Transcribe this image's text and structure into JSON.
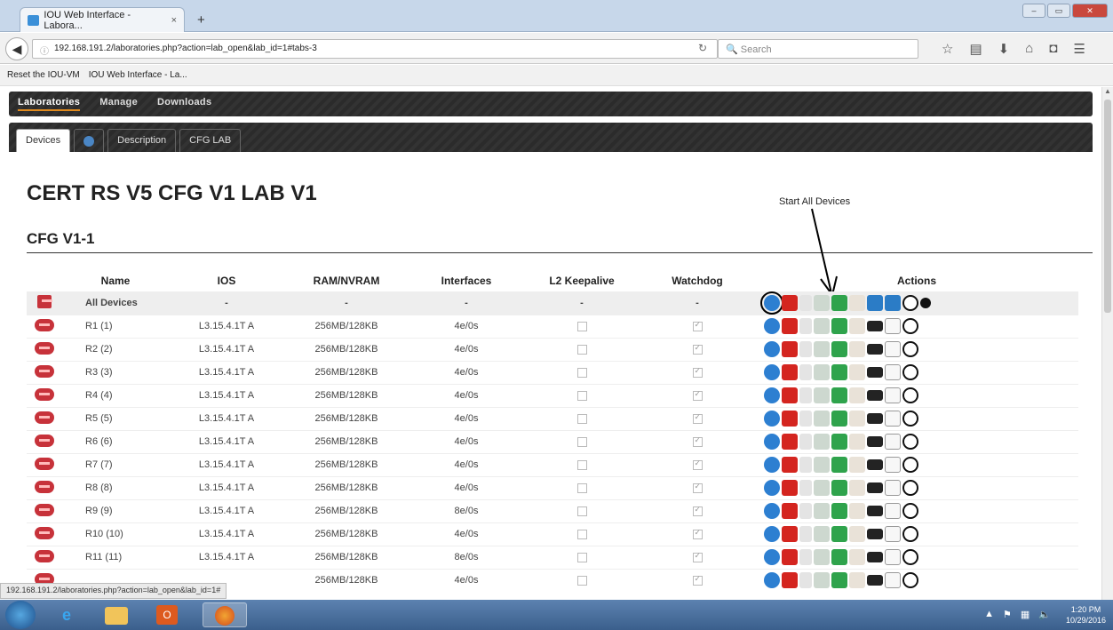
{
  "browser": {
    "tab_title": "IOU Web Interface - Labora...",
    "tab_close": "×",
    "new_tab": "+",
    "url": "192.168.191.2/laboratories.php?action=lab_open&lab_id=1#tabs-3",
    "search_placeholder": "Search",
    "bookmarks": [
      "Reset the IOU-VM",
      "IOU Web Interface - La..."
    ]
  },
  "nav": {
    "items": [
      "Laboratories",
      "Manage",
      "Downloads"
    ],
    "active": "Laboratories"
  },
  "subtabs": [
    "Devices",
    "Description",
    "CFG LAB"
  ],
  "page": {
    "heading": "CERT RS V5 CFG V1 LAB V1",
    "lab_title": "CFG V1-1",
    "annotation": "Start All Devices"
  },
  "table": {
    "headers": [
      "Name",
      "IOS",
      "RAM/NVRAM",
      "Interfaces",
      "L2 Keepalive",
      "Watchdog",
      "Actions"
    ],
    "all_devices": {
      "name": "All Devices",
      "ios": "-",
      "ram": "-",
      "interfaces": "-",
      "keepalive": "-",
      "watchdog": "-"
    },
    "rows": [
      {
        "name": "R1 (1)",
        "ios": "L3.15.4.1T A",
        "ram": "256MB/128KB",
        "interfaces": "4e/0s"
      },
      {
        "name": "R2 (2)",
        "ios": "L3.15.4.1T A",
        "ram": "256MB/128KB",
        "interfaces": "4e/0s"
      },
      {
        "name": "R3 (3)",
        "ios": "L3.15.4.1T A",
        "ram": "256MB/128KB",
        "interfaces": "4e/0s"
      },
      {
        "name": "R4 (4)",
        "ios": "L3.15.4.1T A",
        "ram": "256MB/128KB",
        "interfaces": "4e/0s"
      },
      {
        "name": "R5 (5)",
        "ios": "L3.15.4.1T A",
        "ram": "256MB/128KB",
        "interfaces": "4e/0s"
      },
      {
        "name": "R6 (6)",
        "ios": "L3.15.4.1T A",
        "ram": "256MB/128KB",
        "interfaces": "4e/0s"
      },
      {
        "name": "R7 (7)",
        "ios": "L3.15.4.1T A",
        "ram": "256MB/128KB",
        "interfaces": "4e/0s"
      },
      {
        "name": "R8 (8)",
        "ios": "L3.15.4.1T A",
        "ram": "256MB/128KB",
        "interfaces": "4e/0s"
      },
      {
        "name": "R9 (9)",
        "ios": "L3.15.4.1T A",
        "ram": "256MB/128KB",
        "interfaces": "8e/0s"
      },
      {
        "name": "R10 (10)",
        "ios": "L3.15.4.1T A",
        "ram": "256MB/128KB",
        "interfaces": "4e/0s"
      },
      {
        "name": "R11 (11)",
        "ios": "L3.15.4.1T A",
        "ram": "256MB/128KB",
        "interfaces": "8e/0s"
      },
      {
        "name": "",
        "ios": "",
        "ram": "256MB/128KB",
        "interfaces": "4e/0s"
      }
    ]
  },
  "status_url": "192.168.191.2/laboratories.php?action=lab_open&lab_id=1#",
  "taskbar": {
    "time": "1:20 PM",
    "date": "10/29/2016"
  }
}
